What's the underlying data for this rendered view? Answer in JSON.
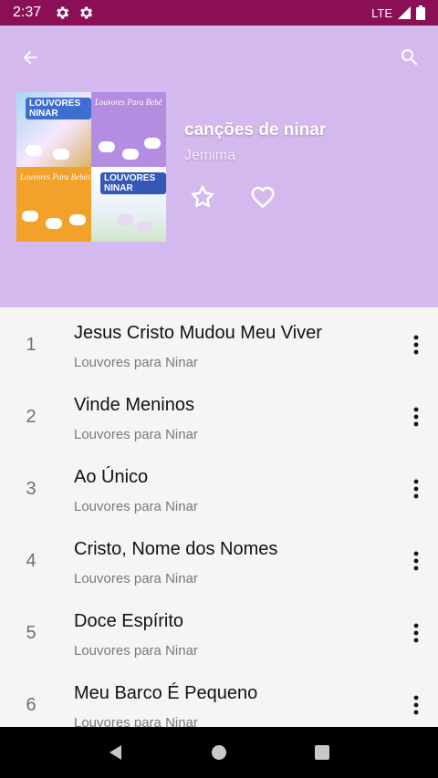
{
  "status_bar": {
    "time": "2:37",
    "network": "LTE"
  },
  "album": {
    "title": "canções de ninar",
    "artist": "Jemima",
    "cover_texts": {
      "t1": "LOUVORES NINAR",
      "t2": "Louvores Para Bebê",
      "t3": "Louvores Para Bebês",
      "t4": "LOUVORES NINAR"
    }
  },
  "tracks": [
    {
      "number": "1",
      "title": "Jesus Cristo Mudou Meu Viver",
      "subtitle": "Louvores para Ninar"
    },
    {
      "number": "2",
      "title": "Vinde Meninos",
      "subtitle": "Louvores para Ninar"
    },
    {
      "number": "3",
      "title": "Ao Único",
      "subtitle": "Louvores para Ninar"
    },
    {
      "number": "4",
      "title": "Cristo, Nome dos Nomes",
      "subtitle": "Louvores para Ninar"
    },
    {
      "number": "5",
      "title": "Doce Espírito",
      "subtitle": "Louvores para Ninar"
    },
    {
      "number": "6",
      "title": "Meu Barco É Pequeno",
      "subtitle": "Louvores para Ninar"
    }
  ],
  "icons": {
    "back": "arrow-back-icon",
    "search": "search-icon",
    "star": "star-outline-icon",
    "heart": "heart-outline-icon",
    "more": "more-vert-icon"
  },
  "colors": {
    "status_bar": "#8a0f56",
    "header": "#d4b9ee",
    "list_bg": "#f5f5f5"
  }
}
